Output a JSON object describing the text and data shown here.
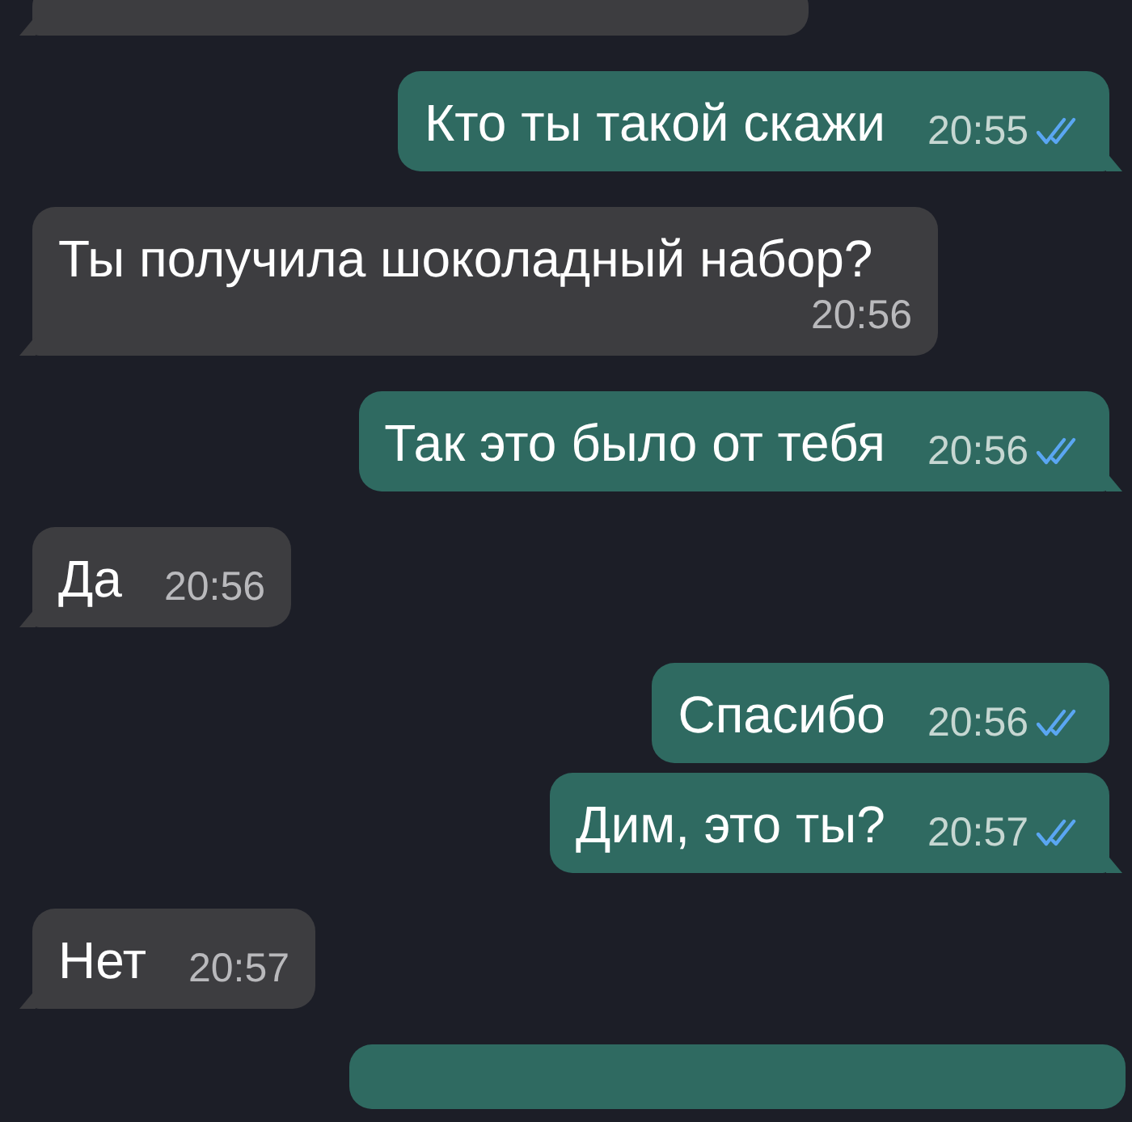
{
  "messages": [
    {
      "kind": "incoming",
      "partial": true,
      "tail": true
    },
    {
      "kind": "outgoing",
      "text": "Кто ты такой скажи",
      "time": "20:55",
      "read": true,
      "tail": true
    },
    {
      "kind": "incoming",
      "text": "Ты получила шоколадный набор?",
      "time": "20:56",
      "tail": true
    },
    {
      "kind": "outgoing",
      "text": "Так это было от тебя",
      "time": "20:56",
      "read": true,
      "tail": true
    },
    {
      "kind": "incoming",
      "text": "Да",
      "time": "20:56",
      "tail": true
    },
    {
      "kind": "outgoing",
      "text": "Спасибо",
      "time": "20:56",
      "read": true,
      "tail": false
    },
    {
      "kind": "outgoing",
      "text": "Дим, это ты?",
      "time": "20:57",
      "read": true,
      "tail": true
    },
    {
      "kind": "incoming",
      "text": "Нет",
      "time": "20:57",
      "tail": true
    },
    {
      "kind": "outgoing",
      "partial": true
    }
  ]
}
